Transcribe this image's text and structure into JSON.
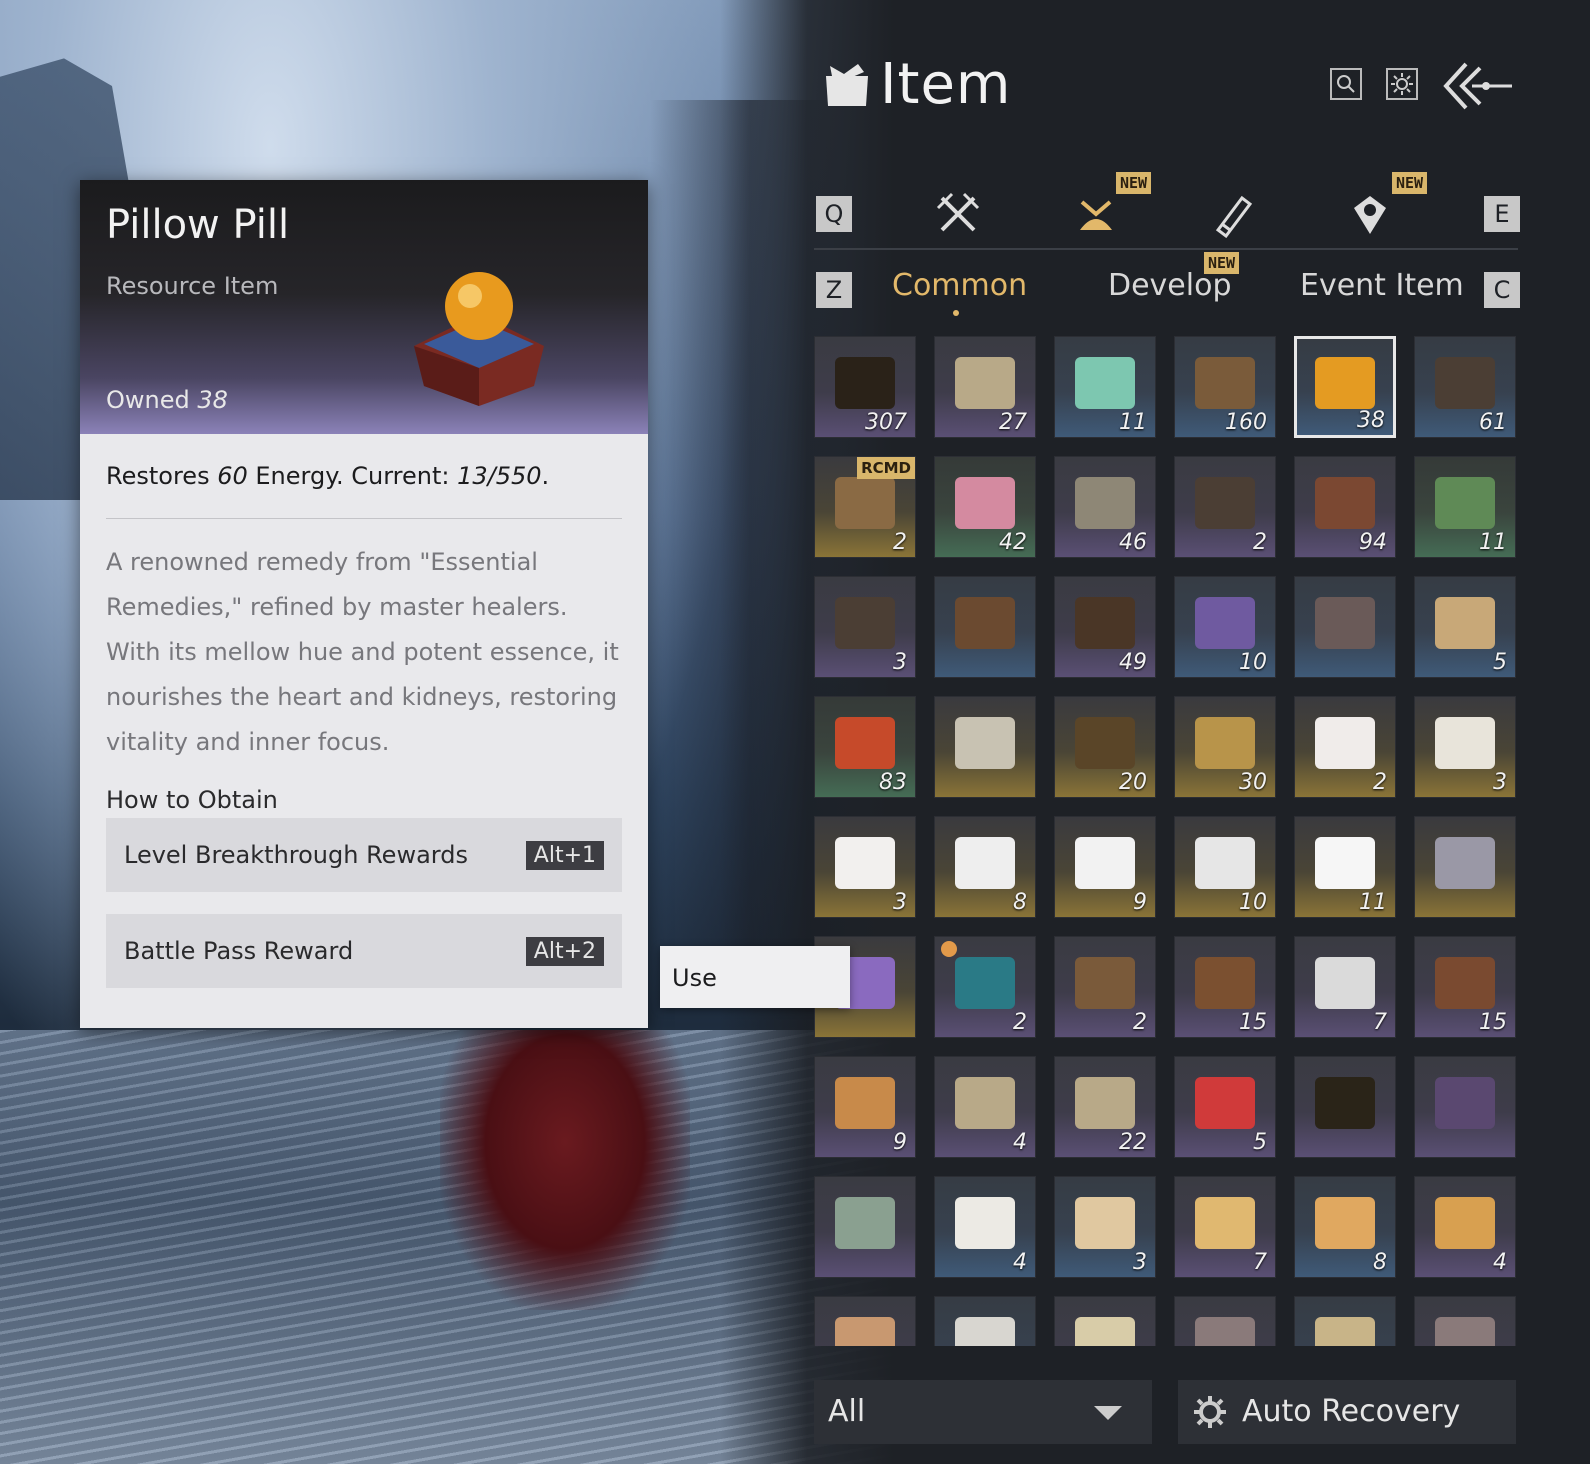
{
  "panel": {
    "title": "Item",
    "keys": {
      "prev_category": "Q",
      "next_category": "E",
      "prev_tab": "Z",
      "next_tab": "C"
    },
    "new_badge": "NEW",
    "subtabs": [
      {
        "label": "Common",
        "active": true
      },
      {
        "label": "Develop",
        "active": false,
        "badge": "NEW"
      },
      {
        "label": "Event Item",
        "active": false
      }
    ],
    "filter": {
      "selected": "All"
    },
    "auto_recovery": "Auto Recovery",
    "rcmd": "RCMD",
    "items": [
      {
        "qty": "307",
        "tone": "purple",
        "color": "#2a2218"
      },
      {
        "qty": "27",
        "tone": "purple",
        "color": "#b8a988"
      },
      {
        "qty": "11",
        "tone": "blue",
        "color": "#7dc7b0"
      },
      {
        "qty": "160",
        "tone": "blue",
        "color": "#7a5b3a"
      },
      {
        "qty": "38",
        "tone": "blue",
        "color": "#e49b22",
        "selected": true
      },
      {
        "qty": "61",
        "tone": "blue",
        "color": "#4b3e34"
      },
      {
        "qty": "2",
        "tone": "gold",
        "color": "#8a6a44",
        "rcmd": true
      },
      {
        "qty": "42",
        "tone": "green",
        "color": "#d48aa0"
      },
      {
        "qty": "46",
        "tone": "purple",
        "color": "#8e8776"
      },
      {
        "qty": "2",
        "tone": "purple",
        "color": "#4b3e34"
      },
      {
        "qty": "94",
        "tone": "purple",
        "color": "#7b4832"
      },
      {
        "qty": "11",
        "tone": "green",
        "color": "#5f8a56"
      },
      {
        "qty": "3",
        "tone": "purple",
        "color": "#4b3e34"
      },
      {
        "qty": "",
        "tone": "blue",
        "color": "#6b4a30"
      },
      {
        "qty": "49",
        "tone": "purple",
        "color": "#4a3626"
      },
      {
        "qty": "10",
        "tone": "blue",
        "color": "#6f5aa0"
      },
      {
        "qty": "",
        "tone": "blue",
        "color": "#6a5a58"
      },
      {
        "qty": "5",
        "tone": "blue",
        "color": "#c8a878"
      },
      {
        "qty": "83",
        "tone": "green",
        "color": "#c64a2a"
      },
      {
        "qty": "",
        "tone": "gold",
        "color": "#c8c2b2"
      },
      {
        "qty": "20",
        "tone": "gold",
        "color": "#5a4528"
      },
      {
        "qty": "30",
        "tone": "gold",
        "color": "#b8944a"
      },
      {
        "qty": "2",
        "tone": "gold",
        "color": "#f0ecea"
      },
      {
        "qty": "3",
        "tone": "gold",
        "color": "#e8e4da"
      },
      {
        "qty": "3",
        "tone": "gold",
        "color": "#f2f0ee"
      },
      {
        "qty": "8",
        "tone": "gold",
        "color": "#eeeeee"
      },
      {
        "qty": "9",
        "tone": "gold",
        "color": "#f2f2f2"
      },
      {
        "qty": "10",
        "tone": "gold",
        "color": "#e6e6e6"
      },
      {
        "qty": "11",
        "tone": "gold",
        "color": "#f6f6f6"
      },
      {
        "qty": "",
        "tone": "gold",
        "color": "#9a98a6"
      },
      {
        "qty": "",
        "tone": "gold",
        "color": "#8a6abf"
      },
      {
        "qty": "2",
        "tone": "purple",
        "color": "#2a7a86",
        "timed": true
      },
      {
        "qty": "2",
        "tone": "purple",
        "color": "#7a5a3a"
      },
      {
        "qty": "15",
        "tone": "purple",
        "color": "#7b5030"
      },
      {
        "qty": "7",
        "tone": "purple",
        "color": "#dadada"
      },
      {
        "qty": "15",
        "tone": "purple",
        "color": "#7a4a30"
      },
      {
        "qty": "9",
        "tone": "purple",
        "color": "#c88a4a"
      },
      {
        "qty": "4",
        "tone": "purple",
        "color": "#b8a988"
      },
      {
        "qty": "22",
        "tone": "purple",
        "color": "#b8a988"
      },
      {
        "qty": "5",
        "tone": "purple",
        "color": "#d03a3a"
      },
      {
        "qty": "",
        "tone": "purple",
        "color": "#2a2418"
      },
      {
        "qty": "",
        "tone": "purple",
        "color": "#5a4870"
      },
      {
        "qty": "",
        "tone": "purple",
        "color": "#8aa090"
      },
      {
        "qty": "4",
        "tone": "blue",
        "color": "#eceae4"
      },
      {
        "qty": "3",
        "tone": "blue",
        "color": "#e0c8a0"
      },
      {
        "qty": "7",
        "tone": "purple",
        "color": "#e0b870"
      },
      {
        "qty": "8",
        "tone": "blue",
        "color": "#e0a860"
      },
      {
        "qty": "4",
        "tone": "purple",
        "color": "#d8a050"
      },
      {
        "qty": "",
        "tone": "purple",
        "color": "#c89870"
      },
      {
        "qty": "",
        "tone": "blue",
        "color": "#d8d6d0"
      },
      {
        "qty": "",
        "tone": "purple",
        "color": "#d8cca8"
      },
      {
        "qty": "",
        "tone": "purple",
        "color": "#8a7a7a"
      },
      {
        "qty": "",
        "tone": "blue",
        "color": "#c8b488"
      },
      {
        "qty": "",
        "tone": "purple",
        "color": "#8a7a7a"
      }
    ]
  },
  "detail": {
    "name": "Pillow Pill",
    "type": "Resource Item",
    "owned_label": "Owned",
    "owned_value": "38",
    "effect_pre": "Restores ",
    "effect_amount": "60",
    "effect_mid": " Energy. Current: ",
    "effect_current": "13/550",
    "effect_post": ".",
    "description": "A renowned remedy from \"Essential Remedies,\" refined by master healers. With its mellow hue and potent essence, it nourishes the heart and kidneys, restoring vitality and inner focus.",
    "obtain_title": "How to Obtain",
    "sources": [
      {
        "label": "Level Breakthrough Rewards",
        "hotkey": "Alt+1"
      },
      {
        "label": "Battle Pass Reward",
        "hotkey": "Alt+2"
      }
    ]
  },
  "context_menu": {
    "use": "Use"
  },
  "colors": {
    "accent": "#e2b86a",
    "badge": "#d9b66b",
    "card_bg": "#e9e9ec"
  }
}
